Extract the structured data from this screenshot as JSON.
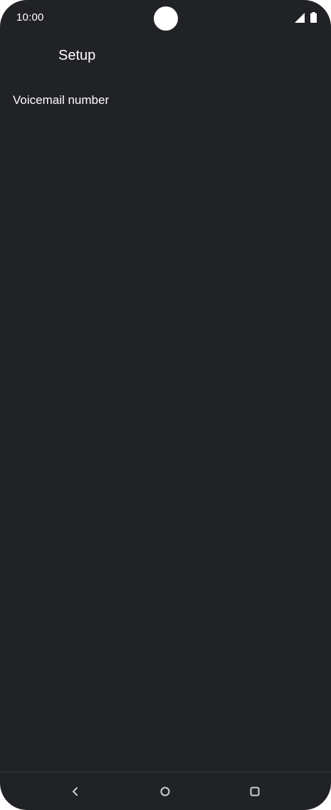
{
  "status_bar": {
    "time": "10:00",
    "icons": [
      "signal-icon",
      "battery-icon"
    ]
  },
  "app_bar": {
    "title": "Setup"
  },
  "preferences": {
    "items": [
      {
        "label": "Voicemail number"
      }
    ]
  },
  "navigation_bar": {
    "buttons": [
      "back-icon",
      "home-icon",
      "recents-icon"
    ]
  },
  "colors": {
    "background": "#212226",
    "text": "#ffffff",
    "icon": "#cfd0d4"
  }
}
